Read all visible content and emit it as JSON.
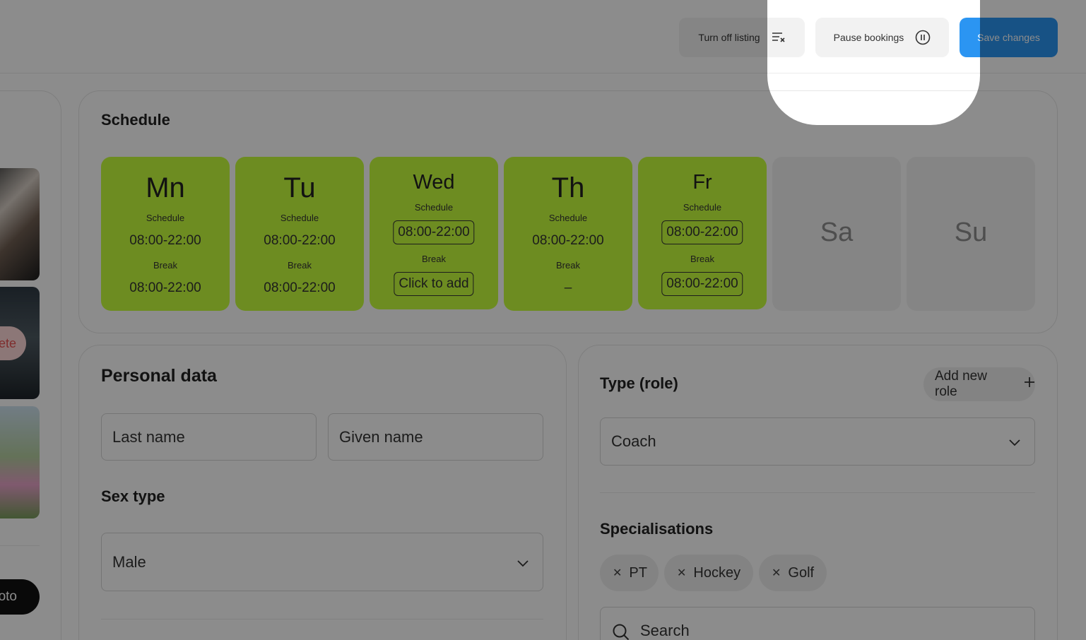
{
  "header": {
    "turn_off_label": "Turn off listing",
    "pause_label": "Pause bookings",
    "save_label": "Save changes"
  },
  "left": {
    "delete_label": "ete",
    "photo_label": "oto"
  },
  "schedule": {
    "title": "Schedule",
    "days": [
      {
        "name": "Mn",
        "schedule_label": "Schedule",
        "schedule": "08:00-22:00",
        "break_label": "Break",
        "break": "08:00-22:00"
      },
      {
        "name": "Tu",
        "schedule_label": "Schedule",
        "schedule": "08:00-22:00",
        "break_label": "Break",
        "break": "08:00-22:00"
      },
      {
        "name": "Wed",
        "schedule_label": "Schedule",
        "schedule": "08:00-22:00",
        "break_label": "Break",
        "break": "Click to add"
      },
      {
        "name": "Th",
        "schedule_label": "Schedule",
        "schedule": "08:00-22:00",
        "break_label": "Break",
        "break": "–"
      },
      {
        "name": "Fr",
        "schedule_label": "Schedule",
        "schedule": "08:00-22:00",
        "break_label": "Break",
        "break": "08:00-22:00"
      },
      {
        "name": "Sa"
      },
      {
        "name": "Su"
      }
    ]
  },
  "personal": {
    "title": "Personal data",
    "last_name_placeholder": "Last name",
    "given_name_placeholder": "Given name",
    "sex_title": "Sex type",
    "sex_value": "Male"
  },
  "role": {
    "title": "Type (role)",
    "add_role_label": "Add new role",
    "role_value": "Coach",
    "specialisations_title": "Specialisations",
    "chips": [
      "PT",
      "Hockey",
      "Golf"
    ],
    "search_placeholder": "Search"
  },
  "colors": {
    "active_day": "#c6ff3d",
    "inactive_day": "#f3f3f3",
    "primary": "#2b95f2",
    "overlay": "rgba(0,0,0,0.45)"
  }
}
